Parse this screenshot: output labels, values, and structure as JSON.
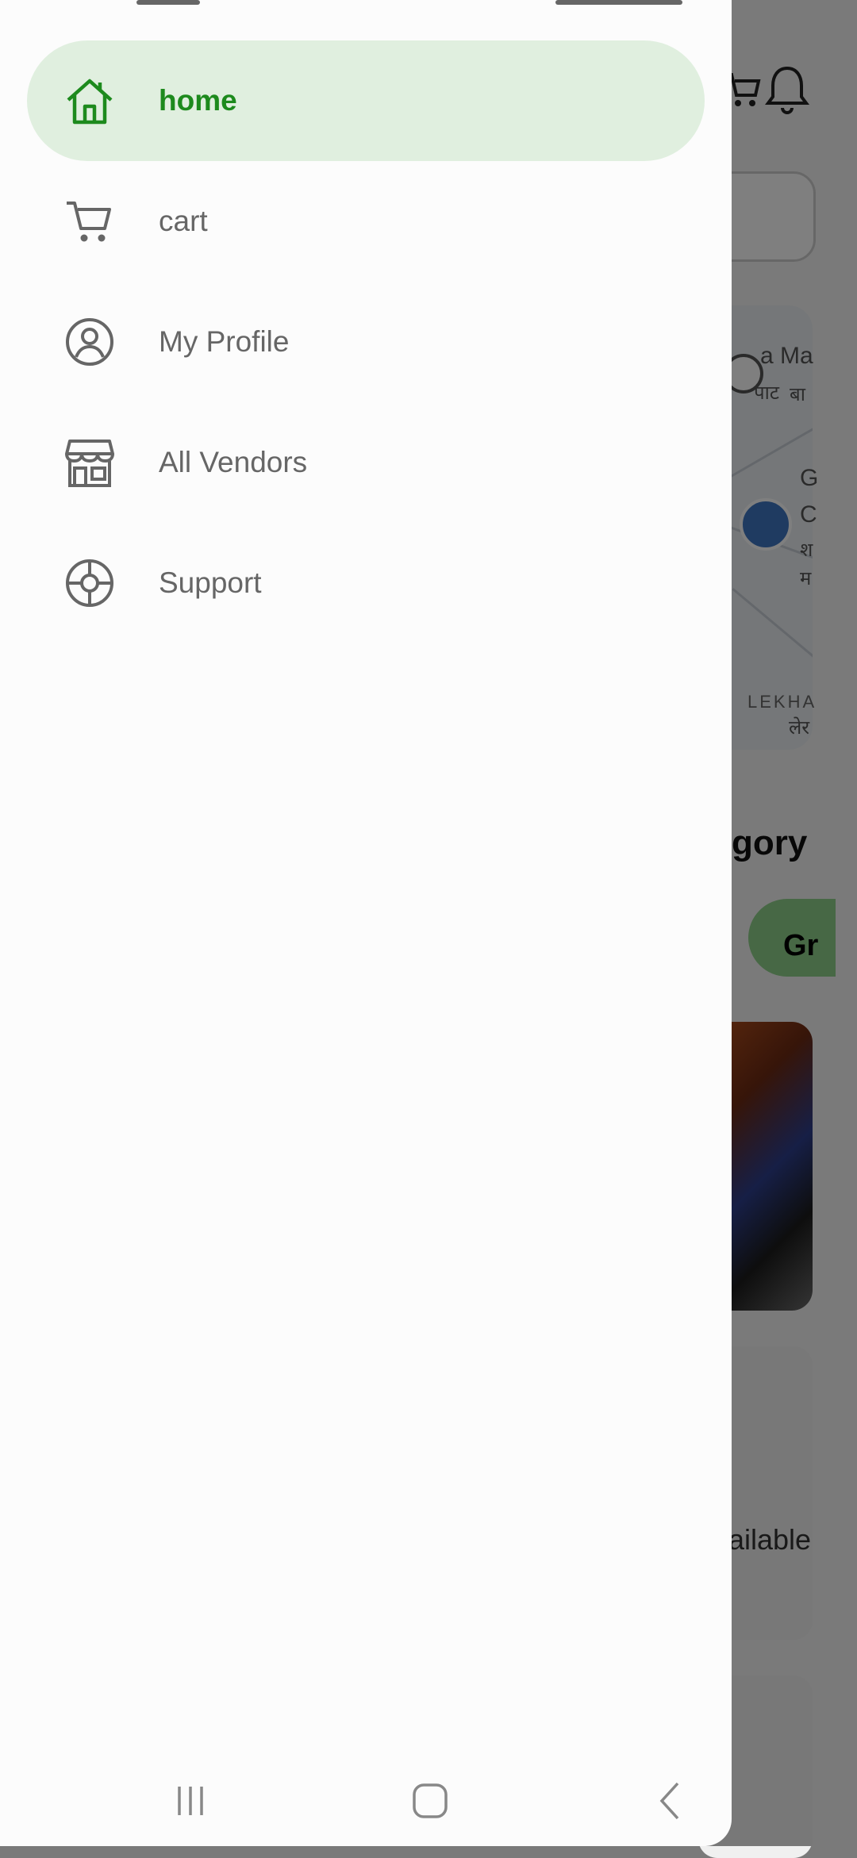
{
  "drawer": {
    "items": [
      {
        "label": "home",
        "icon": "home-icon",
        "active": true
      },
      {
        "label": "cart",
        "icon": "cart-icon",
        "active": false
      },
      {
        "label": "My Profile",
        "icon": "profile-icon",
        "active": false
      },
      {
        "label": "All Vendors",
        "icon": "store-icon",
        "active": false
      },
      {
        "label": "Support",
        "icon": "support-icon",
        "active": false
      }
    ]
  },
  "background": {
    "category_title_fragment": "gory",
    "chip_fragment": "Gr",
    "card_text_fragment": "ailable",
    "map_texts": [
      "a Ma",
      "पाट",
      "बा",
      "G",
      "C",
      "श",
      "म",
      "LEKHA",
      "लेर"
    ]
  },
  "colors": {
    "accent": "#1d8a1d",
    "active_bg": "#e0efdf",
    "text_muted": "#666666"
  },
  "system_nav": {
    "buttons": [
      "recent-apps-icon",
      "home-button-icon",
      "back-icon"
    ]
  }
}
